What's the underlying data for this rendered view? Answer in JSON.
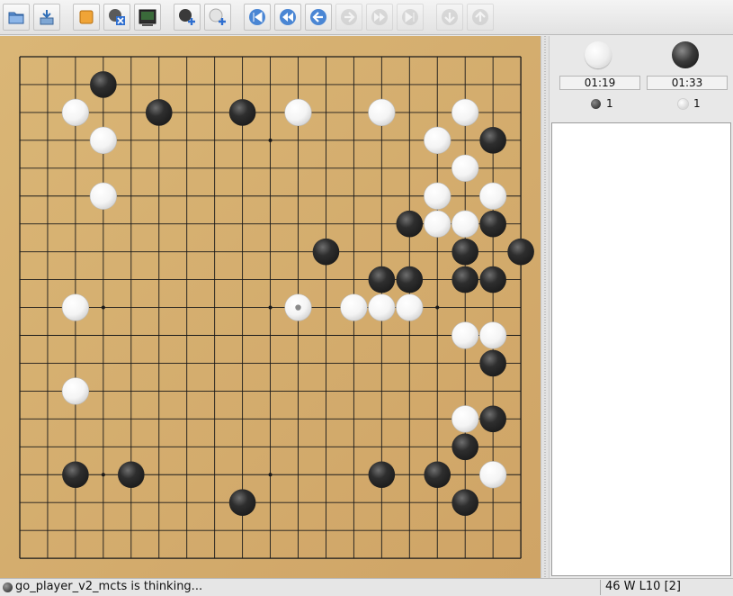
{
  "toolbar": {
    "buttons": [
      {
        "name": "open-file-button",
        "icon": "folder-icon"
      },
      {
        "name": "save-file-button",
        "icon": "save-icon"
      },
      {
        "name": "new-game-button",
        "icon": "new-game-icon"
      },
      {
        "name": "detach-program-button",
        "icon": "detach-program-icon"
      },
      {
        "name": "gtp-shell-button",
        "icon": "terminal-icon"
      },
      {
        "name": "play-black-button",
        "icon": "black-stone-plus-icon"
      },
      {
        "name": "play-white-button",
        "icon": "white-stone-plus-icon"
      },
      {
        "name": "beginning-button",
        "icon": "go-to-start-icon"
      },
      {
        "name": "backward-ten-button",
        "icon": "fast-backward-icon"
      },
      {
        "name": "backward-button",
        "icon": "backward-icon"
      },
      {
        "name": "forward-button",
        "icon": "forward-icon"
      },
      {
        "name": "forward-ten-button",
        "icon": "fast-forward-icon"
      },
      {
        "name": "end-button",
        "icon": "go-to-end-icon"
      },
      {
        "name": "next-variation-button",
        "icon": "variation-down-icon"
      },
      {
        "name": "previous-variation-button",
        "icon": "variation-up-icon"
      }
    ]
  },
  "board": {
    "size": 19,
    "colors": {
      "wood": "#d4ad6e",
      "line": "#1a1a1a",
      "black": "#1c1c1c",
      "white": "#f4f4f4"
    },
    "hoshi": [
      [
        3,
        3
      ],
      [
        3,
        9
      ],
      [
        3,
        15
      ],
      [
        9,
        3
      ],
      [
        9,
        9
      ],
      [
        9,
        15
      ],
      [
        15,
        3
      ],
      [
        15,
        9
      ],
      [
        15,
        15
      ]
    ],
    "black_stones": [
      [
        1,
        3
      ],
      [
        2,
        5
      ],
      [
        2,
        8
      ],
      [
        3,
        17
      ],
      [
        6,
        14
      ],
      [
        6,
        17
      ],
      [
        7,
        11
      ],
      [
        7,
        16
      ],
      [
        7,
        18
      ],
      [
        8,
        13
      ],
      [
        8,
        14
      ],
      [
        8,
        16
      ],
      [
        8,
        17
      ],
      [
        11,
        17
      ],
      [
        13,
        17
      ],
      [
        14,
        16
      ],
      [
        15,
        2
      ],
      [
        15,
        4
      ],
      [
        15,
        13
      ],
      [
        15,
        15
      ],
      [
        16,
        8
      ],
      [
        16,
        16
      ]
    ],
    "white_stones": [
      [
        2,
        2
      ],
      [
        2,
        10
      ],
      [
        2,
        13
      ],
      [
        2,
        16
      ],
      [
        3,
        3
      ],
      [
        3,
        15
      ],
      [
        4,
        16
      ],
      [
        5,
        3
      ],
      [
        5,
        15
      ],
      [
        5,
        17
      ],
      [
        6,
        15
      ],
      [
        6,
        16
      ],
      [
        9,
        2
      ],
      [
        9,
        10
      ],
      [
        9,
        12
      ],
      [
        9,
        13
      ],
      [
        9,
        14
      ],
      [
        10,
        16
      ],
      [
        10,
        17
      ],
      [
        12,
        2
      ],
      [
        13,
        16
      ],
      [
        15,
        17
      ]
    ],
    "last_move": [
      9,
      10
    ]
  },
  "clocks": {
    "white": {
      "time": "01:19",
      "captures": "1"
    },
    "black": {
      "time": "01:33",
      "captures": "1"
    }
  },
  "status": {
    "text": "go_player_v2_mcts is thinking...",
    "move_info": "46 W L10 [2]"
  }
}
